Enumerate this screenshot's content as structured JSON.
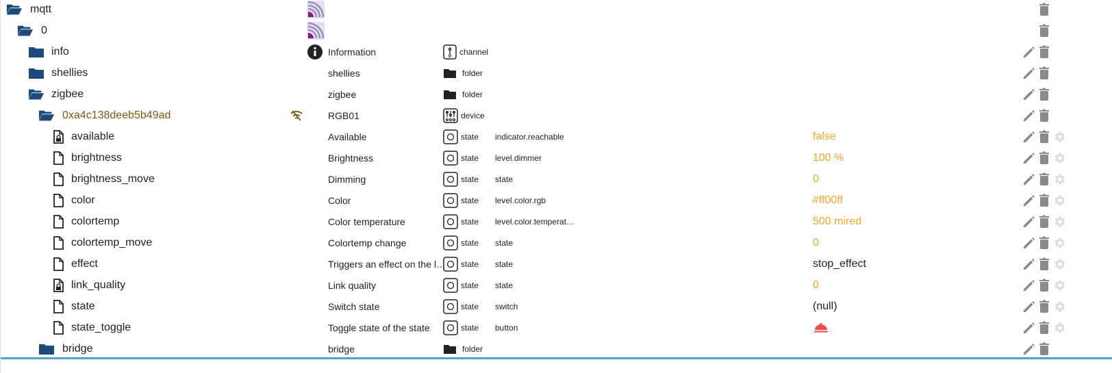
{
  "colors": {
    "folder": "#1c4a7c",
    "value_num": "#f5a623",
    "device_id": "#7a5a10",
    "button_bell": "#f44a4a",
    "accent": "#4fa3d8"
  },
  "rows": [
    {
      "id": "mqtt",
      "level": 0,
      "kind": "folder-open",
      "adapter_icon": true
    },
    {
      "id": "0",
      "level": 1,
      "kind": "folder-open",
      "adapter_icon": true
    },
    {
      "id": "info",
      "level": 2,
      "kind": "folder",
      "name": "Information",
      "type": "channel",
      "type_icon": "channel-icon",
      "info_icon": true,
      "edit": true
    },
    {
      "id": "shellies",
      "level": 2,
      "kind": "folder",
      "name": "shellies",
      "type": "folder",
      "type_icon": "folder-icon",
      "edit": true
    },
    {
      "id": "zigbee",
      "level": 2,
      "kind": "folder-open",
      "name": "zigbee",
      "type": "folder",
      "type_icon": "folder-icon",
      "edit": true
    },
    {
      "id": "0xa4c138deeb5b49ad",
      "level": 3,
      "kind": "folder-open",
      "device": true,
      "wifi_off": true,
      "name": "RGB01",
      "type": "device",
      "type_icon": "device-icon",
      "edit": true
    },
    {
      "id": "available",
      "level": 4,
      "kind": "file-lock",
      "name": "Available",
      "type": "state",
      "role": "indicator.reachable",
      "value": "false",
      "value_style": "num",
      "gear": true,
      "edit": true
    },
    {
      "id": "brightness",
      "level": 4,
      "kind": "file",
      "name": "Brightness",
      "type": "state",
      "role": "level.dimmer",
      "value": "100 %",
      "value_style": "num",
      "gear": true,
      "edit": true
    },
    {
      "id": "brightness_move",
      "level": 4,
      "kind": "file",
      "name": "Dimming",
      "type": "state",
      "role": "state",
      "value": "0",
      "value_style": "num",
      "gear": true,
      "edit": true
    },
    {
      "id": "color",
      "level": 4,
      "kind": "file",
      "name": "Color",
      "type": "state",
      "role": "level.color.rgb",
      "value": "#ff00ff",
      "value_style": "num",
      "gear": true,
      "edit": true
    },
    {
      "id": "colortemp",
      "level": 4,
      "kind": "file",
      "name": "Color temperature",
      "type": "state",
      "role": "level.color.temperat…",
      "value": "500 mired",
      "value_style": "num",
      "gear": true,
      "edit": true
    },
    {
      "id": "colortemp_move",
      "level": 4,
      "kind": "file",
      "name": "Colortemp change",
      "type": "state",
      "role": "state",
      "value": "0",
      "value_style": "num",
      "gear": true,
      "edit": true
    },
    {
      "id": "effect",
      "level": 4,
      "kind": "file",
      "name": "Triggers an effect on the l…",
      "type": "state",
      "role": "state",
      "value": "stop_effect",
      "value_style": "text",
      "gear": true,
      "edit": true
    },
    {
      "id": "link_quality",
      "level": 4,
      "kind": "file-lock",
      "name": "Link quality",
      "type": "state",
      "role": "state",
      "value": "0",
      "value_style": "num",
      "gear": true,
      "edit": true
    },
    {
      "id": "state",
      "level": 4,
      "kind": "file",
      "name": "Switch state",
      "type": "state",
      "role": "switch",
      "value": "(null)",
      "value_style": "text",
      "gear": true,
      "edit": true
    },
    {
      "id": "state_toggle",
      "level": 4,
      "kind": "file",
      "name": "Toggle state of the state",
      "type": "state",
      "role": "button",
      "value_icon": "bell-button-icon",
      "gear": true,
      "edit": true
    },
    {
      "id": "bridge",
      "level": 3,
      "kind": "folder",
      "name": "bridge",
      "type": "folder",
      "type_icon": "folder-icon",
      "edit": true
    }
  ]
}
